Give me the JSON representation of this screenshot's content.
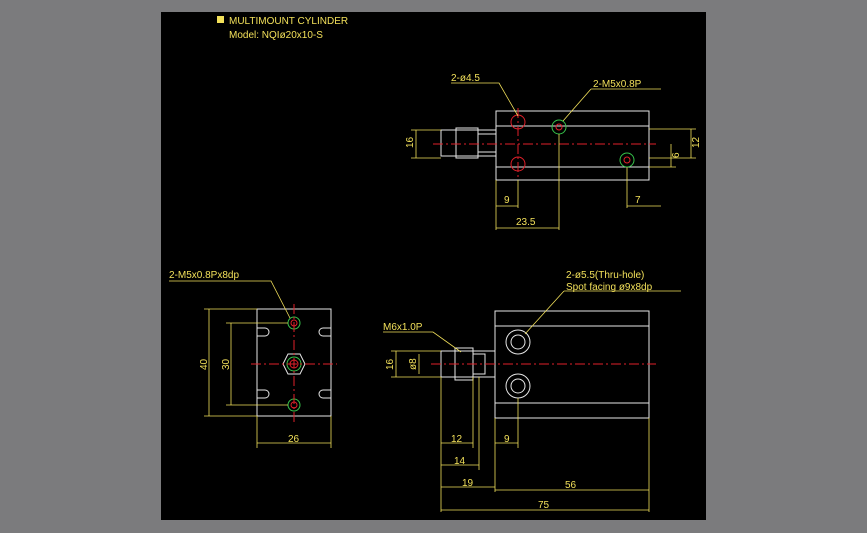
{
  "title": {
    "heading": "MULTIMOUNT CYLINDER",
    "model": "Model: NQIø20x10-S"
  },
  "top_view": {
    "callout_holes": "2-ø4.5",
    "callout_taps": "2-M5x0.8P",
    "dims": {
      "rod_dia": "16",
      "height": "12",
      "offset": "6",
      "hole_pos": "9",
      "tap_pos": "7",
      "length": "23.5"
    }
  },
  "end_view": {
    "callout": "2-M5x0.8Px8dp",
    "dims": {
      "height": "40",
      "pitch": "30",
      "width": "26"
    }
  },
  "side_view": {
    "callout_thru_line1": "2-ø5.5(Thru-hole)",
    "callout_thru_line2": "Spot facing ø9x8dp",
    "callout_thread": "M6x1.0P",
    "dims": {
      "rod_boss": "16",
      "rod_dia": "ø8",
      "rod_len": "12",
      "rod_ext": "14",
      "front": "19",
      "body": "56",
      "total": "75",
      "hole_pos": "9"
    }
  },
  "colors": {
    "background": "#7b7b7d",
    "drawing": "#000000",
    "dimension": "#f2e05a",
    "outline": "#e6e6e6",
    "centerline": "#e0202a",
    "thread": "#36c24a"
  }
}
